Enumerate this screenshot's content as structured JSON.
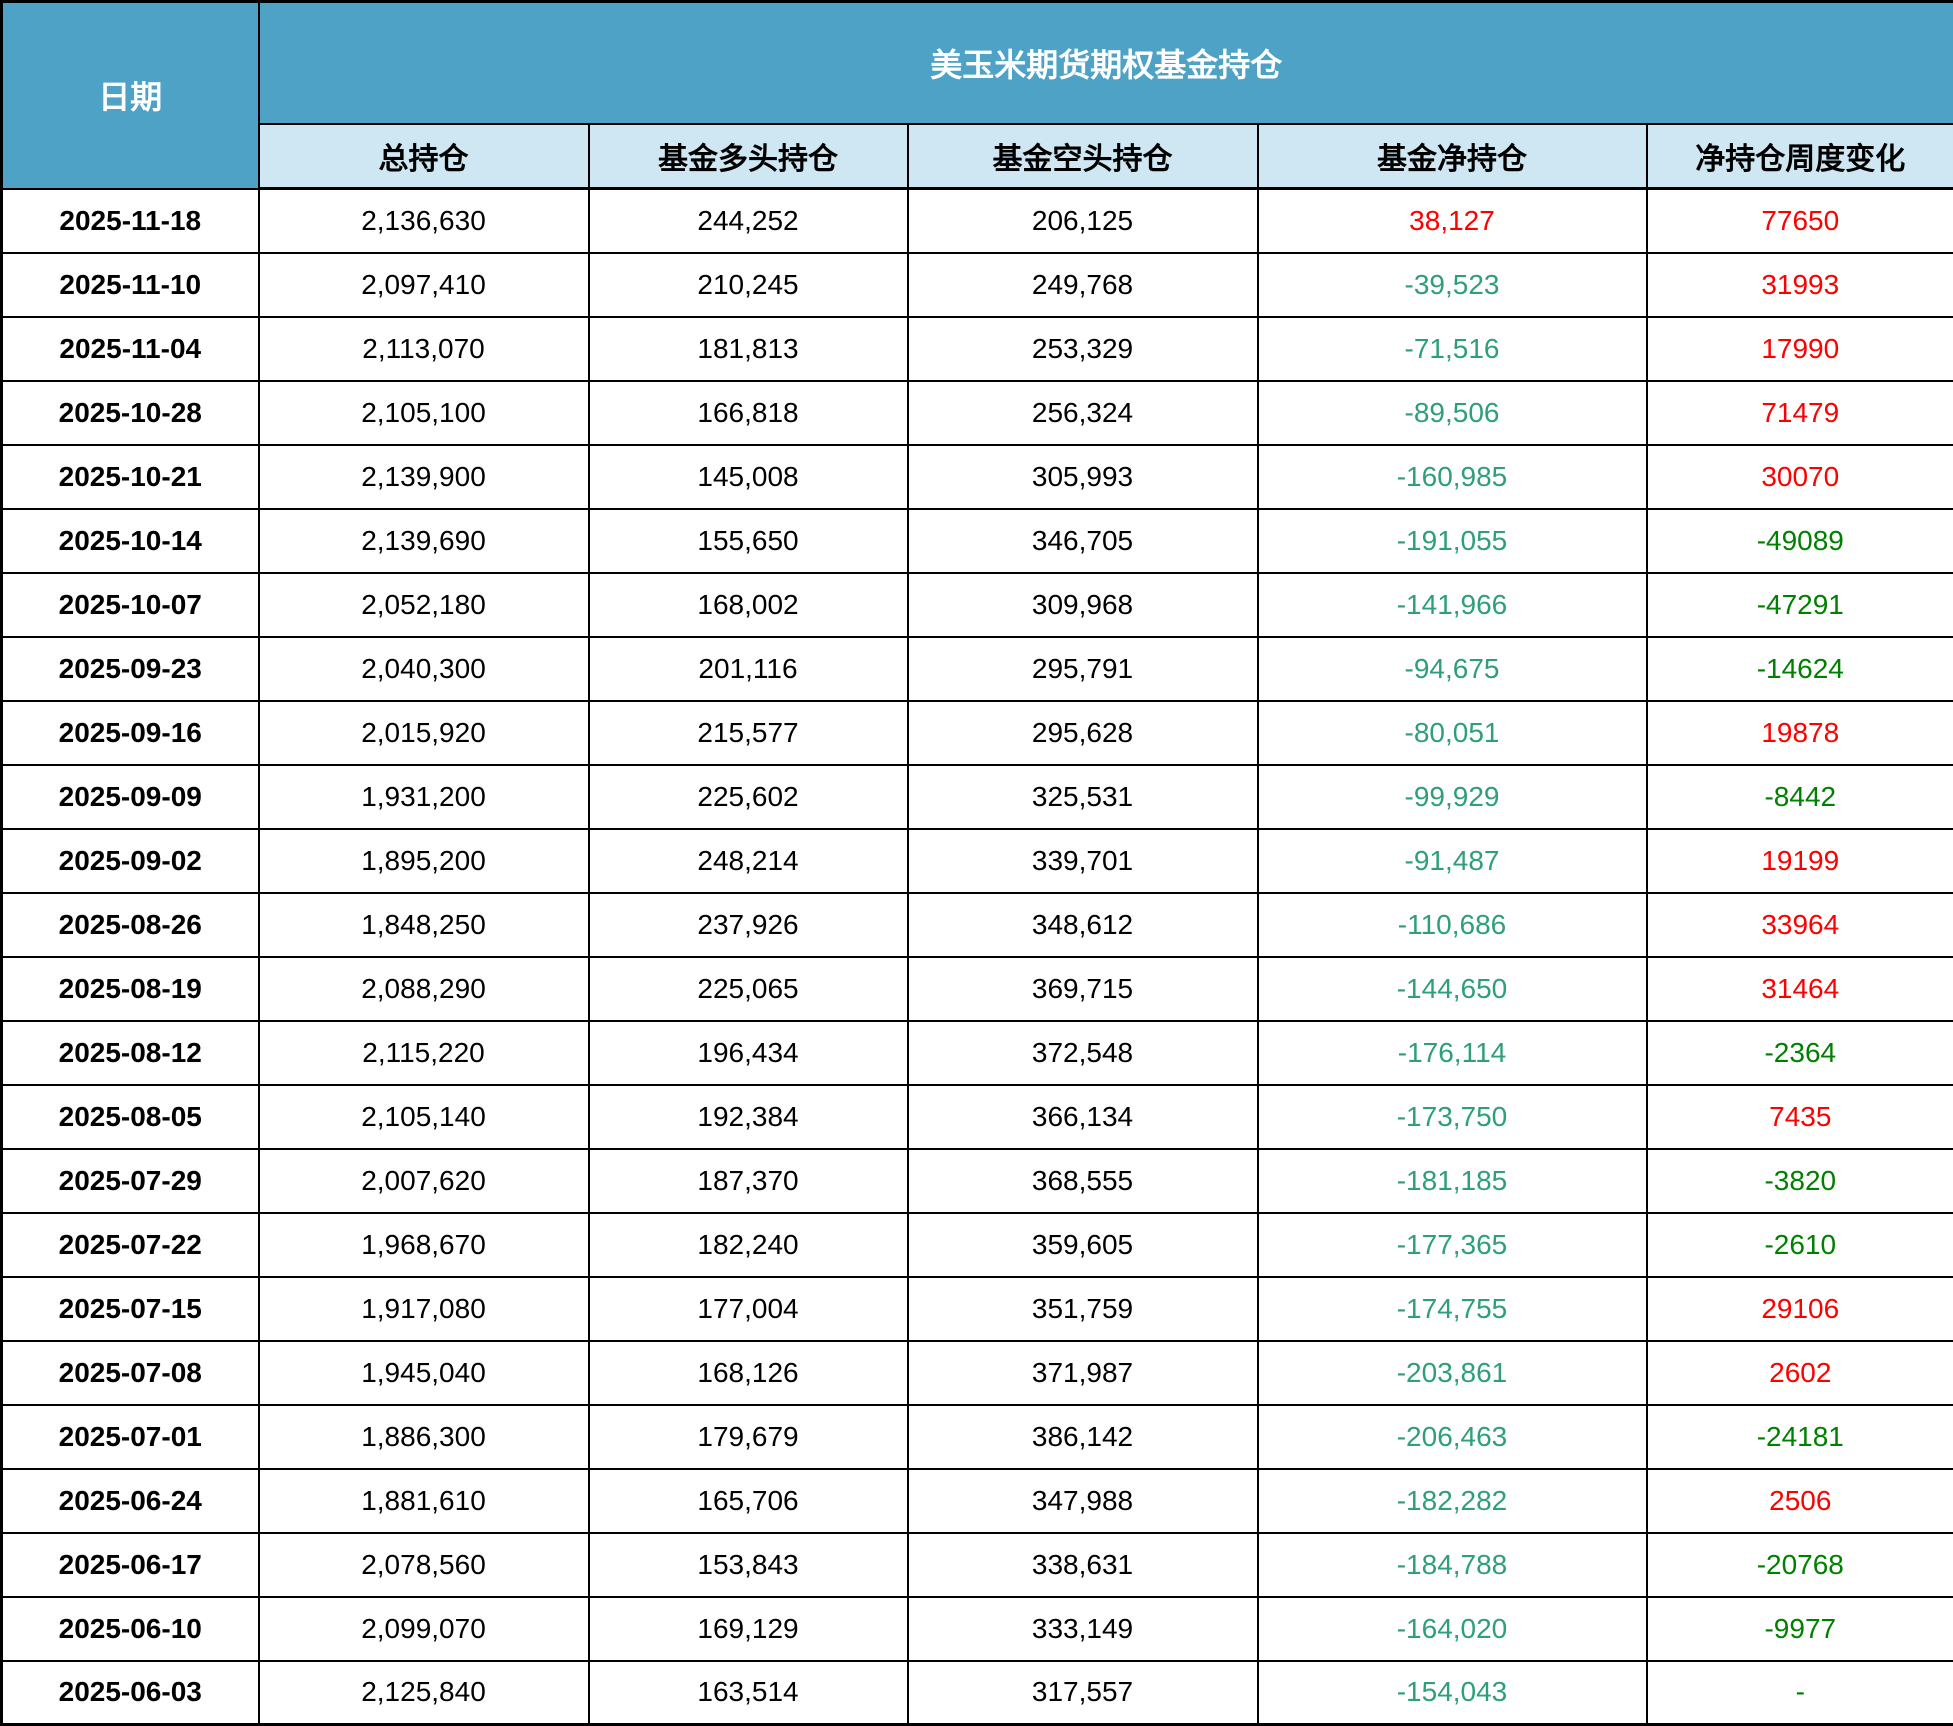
{
  "header": {
    "date_label": "日期",
    "group_title": "美玉米期货期权基金持仓",
    "subcolumns": [
      "总持仓",
      "基金多头持仓",
      "基金空头持仓",
      "基金净持仓",
      "净持仓周度变化"
    ]
  },
  "placeholders": {
    "empty_value": "-"
  },
  "colors": {
    "header_bg": "#4da2c6",
    "subheader_bg": "#cee7f2",
    "positive_red": "#fe0000",
    "net_negative_green": "#2e9f77",
    "change_negative_green": "#008000"
  },
  "chart_data": {
    "type": "table",
    "title": "美玉米期货期权基金持仓",
    "columns": [
      "日期",
      "总持仓",
      "基金多头持仓",
      "基金空头持仓",
      "基金净持仓",
      "净持仓周度变化"
    ],
    "comma_formatted_columns": [
      1,
      2,
      3,
      4
    ],
    "rows": [
      [
        "2025-11-18",
        2136630,
        244252,
        206125,
        38127,
        77650
      ],
      [
        "2025-11-10",
        2097410,
        210245,
        249768,
        -39523,
        31993
      ],
      [
        "2025-11-04",
        2113070,
        181813,
        253329,
        -71516,
        17990
      ],
      [
        "2025-10-28",
        2105100,
        166818,
        256324,
        -89506,
        71479
      ],
      [
        "2025-10-21",
        2139900,
        145008,
        305993,
        -160985,
        30070
      ],
      [
        "2025-10-14",
        2139690,
        155650,
        346705,
        -191055,
        -49089
      ],
      [
        "2025-10-07",
        2052180,
        168002,
        309968,
        -141966,
        -47291
      ],
      [
        "2025-09-23",
        2040300,
        201116,
        295791,
        -94675,
        -14624
      ],
      [
        "2025-09-16",
        2015920,
        215577,
        295628,
        -80051,
        19878
      ],
      [
        "2025-09-09",
        1931200,
        225602,
        325531,
        -99929,
        -8442
      ],
      [
        "2025-09-02",
        1895200,
        248214,
        339701,
        -91487,
        19199
      ],
      [
        "2025-08-26",
        1848250,
        237926,
        348612,
        -110686,
        33964
      ],
      [
        "2025-08-19",
        2088290,
        225065,
        369715,
        -144650,
        31464
      ],
      [
        "2025-08-12",
        2115220,
        196434,
        372548,
        -176114,
        -2364
      ],
      [
        "2025-08-05",
        2105140,
        192384,
        366134,
        -173750,
        7435
      ],
      [
        "2025-07-29",
        2007620,
        187370,
        368555,
        -181185,
        -3820
      ],
      [
        "2025-07-22",
        1968670,
        182240,
        359605,
        -177365,
        -2610
      ],
      [
        "2025-07-15",
        1917080,
        177004,
        351759,
        -174755,
        29106
      ],
      [
        "2025-07-08",
        1945040,
        168126,
        371987,
        -203861,
        2602
      ],
      [
        "2025-07-01",
        1886300,
        179679,
        386142,
        -206463,
        -24181
      ],
      [
        "2025-06-24",
        1881610,
        165706,
        347988,
        -182282,
        2506
      ],
      [
        "2025-06-17",
        2078560,
        153843,
        338631,
        -184788,
        -20768
      ],
      [
        "2025-06-10",
        2099070,
        169129,
        333149,
        -164020,
        -9977
      ],
      [
        "2025-06-03",
        2125840,
        163514,
        317557,
        -154043,
        null
      ]
    ]
  }
}
